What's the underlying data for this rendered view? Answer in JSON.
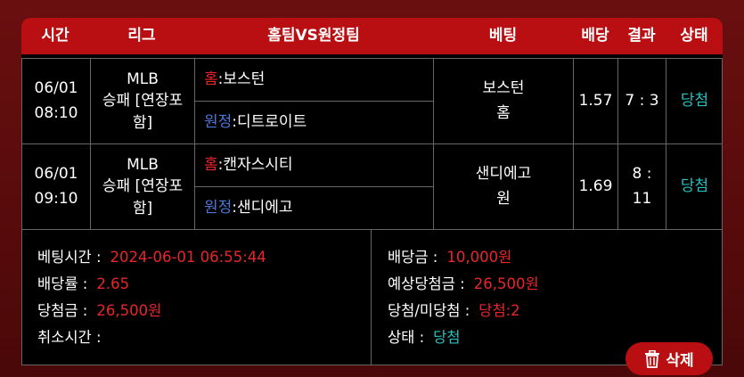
{
  "header": {
    "time": "시간",
    "league": "리그",
    "matchup": "홈팀VS원정팀",
    "bet": "베팅",
    "odds": "배당",
    "result": "결과",
    "status": "상태"
  },
  "rows": [
    {
      "date": "06/01",
      "time": "08:10",
      "league_line1": "MLB",
      "league_line2": "승패 [연장포",
      "league_line3": "함]",
      "home_tag": "홈",
      "home_team": " :보스턴",
      "away_tag": "원정",
      "away_team": " :디트로이트",
      "bet_line1": "보스턴",
      "bet_line2": "홈",
      "odds": "1.57",
      "result": "7 : 3",
      "status": "당첨"
    },
    {
      "date": "06/01",
      "time": "09:10",
      "league_line1": "MLB",
      "league_line2": "승패 [연장포",
      "league_line3": "함]",
      "home_tag": "홈",
      "home_team": " :캔자스시티",
      "away_tag": "원정",
      "away_team": " :샌디에고",
      "bet_line1": "샌디에고",
      "bet_line2": "원",
      "odds": "1.69",
      "result_line1": "8 :",
      "result_line2": "11",
      "status": "당첨"
    }
  ],
  "summary": {
    "bet_time_label": "베팅시간 :",
    "bet_time_value": "2024-06-01 06:55:44",
    "odds_rate_label": "배당률 :",
    "odds_rate_value": "2.65",
    "win_amount_label": "당첨금 :",
    "win_amount_value": "26,500원",
    "cancel_time_label": "취소시간 :",
    "cancel_time_value": "",
    "bet_amount_label": "배당금 :",
    "bet_amount_value": "10,000원",
    "expected_win_label": "예상당첨금 :",
    "expected_win_value": "26,500원",
    "win_lose_label": "당첨/미당첨 :",
    "win_lose_value": "당첨:2",
    "status_label": "상태 :",
    "status_value": "당첨"
  },
  "delete_button": {
    "label": "삭제",
    "icon": "trash-icon"
  },
  "colors": {
    "accent": "#b90f12",
    "win": "#23c0c0",
    "value": "#e8262a",
    "away": "#4a78d6"
  }
}
